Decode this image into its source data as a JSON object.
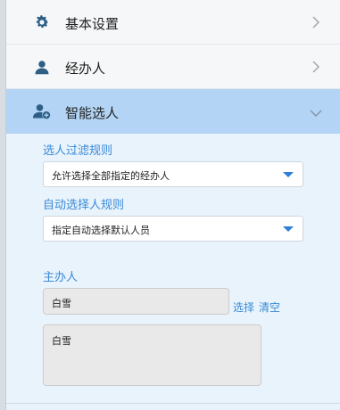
{
  "sections": [
    {
      "label": "基本设置",
      "icon": "gear-icon"
    },
    {
      "label": "经办人",
      "icon": "user-icon"
    },
    {
      "label": "智能选人",
      "icon": "user-add-icon"
    }
  ],
  "smart_select": {
    "filter_rule_label": "选人过滤规则",
    "filter_rule_value": "允许选择全部指定的经办人",
    "auto_rule_label": "自动选择人规则",
    "auto_rule_value": "指定自动选择默认人员",
    "host_label": "主办人",
    "host_value": "白雪",
    "select_link": "选择",
    "clear_link": "清空",
    "handlers_value": "白雪"
  },
  "colors": {
    "accent": "#3a8ad6",
    "active_header": "#b3d4f5",
    "body_bg": "#e8f3fc",
    "icon": "#2d5f86"
  }
}
